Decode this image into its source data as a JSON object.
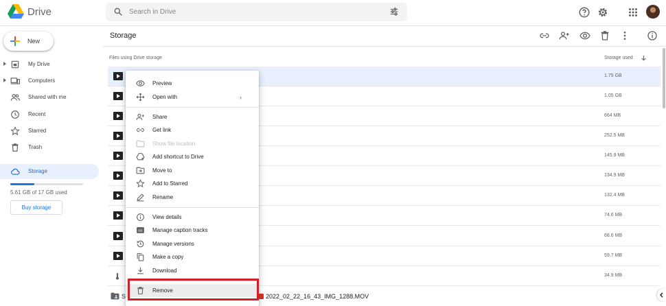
{
  "app": {
    "name": "Drive"
  },
  "search": {
    "placeholder": "Search in Drive"
  },
  "sidebar": {
    "new_label": "New",
    "items": [
      {
        "label": "My Drive"
      },
      {
        "label": "Computers"
      },
      {
        "label": "Shared with me"
      },
      {
        "label": "Recent"
      },
      {
        "label": "Starred"
      },
      {
        "label": "Trash"
      },
      {
        "label": "Storage"
      }
    ],
    "storage_used_fraction": 0.33,
    "storage_text": "5.61 GB of 17 GB used",
    "buy_storage_label": "Buy storage"
  },
  "main": {
    "title": "Storage",
    "col_files": "Files using Drive storage",
    "col_storage": "Storage used",
    "rows": [
      {
        "size": "1.75 GB"
      },
      {
        "size": "1.05 GB"
      },
      {
        "size": "664 MB"
      },
      {
        "size": "252.5 MB"
      },
      {
        "size": "145.9 MB"
      },
      {
        "size": "134.9 MB"
      },
      {
        "size": "132.4 MB"
      },
      {
        "size": "74.6 MB"
      },
      {
        "size": "68.6 MB"
      },
      {
        "size": "59.7 MB"
      },
      {
        "size": "34.9 MB"
      }
    ],
    "last_row": {
      "prefix": "S",
      "filename": "2022_02_22_16_43_IMG_1288.MOV"
    }
  },
  "context_menu": {
    "items": [
      {
        "label": "Preview"
      },
      {
        "label": "Open with",
        "submenu": "›"
      },
      {
        "label": "Share"
      },
      {
        "label": "Get link"
      },
      {
        "label": "Show file location",
        "disabled": true
      },
      {
        "label": "Add shortcut to Drive"
      },
      {
        "label": "Move to"
      },
      {
        "label": "Add to Starred"
      },
      {
        "label": "Rename"
      },
      {
        "label": "View details"
      },
      {
        "label": "Manage caption tracks"
      },
      {
        "label": "Manage versions"
      },
      {
        "label": "Make a copy"
      },
      {
        "label": "Download"
      },
      {
        "label": "Remove",
        "highlighted": true
      }
    ]
  },
  "colors": {
    "accent": "#1a73e8",
    "selection": "#e8f0fe",
    "highlight_border": "#d0202a"
  }
}
